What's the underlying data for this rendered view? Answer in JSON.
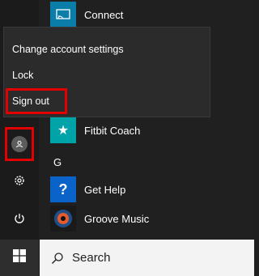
{
  "apps": {
    "connect": {
      "label": "Connect",
      "icon": "cast-icon",
      "color": "#0a7ea8"
    },
    "fitbit": {
      "label": "Fitbit Coach",
      "icon": "star-icon",
      "color": "#00a3a8"
    },
    "group_letter": "G",
    "get_help": {
      "label": "Get Help",
      "icon": "help-icon",
      "color": "#0a63c9"
    },
    "groove": {
      "label": "Groove Music",
      "icon": "music-disc-icon",
      "color": "#1a1a1a"
    }
  },
  "account_menu": {
    "items": [
      "Change account settings",
      "Lock",
      "Sign out"
    ]
  },
  "highlight_color": "#e30000",
  "taskbar": {
    "search_label": "Search"
  }
}
